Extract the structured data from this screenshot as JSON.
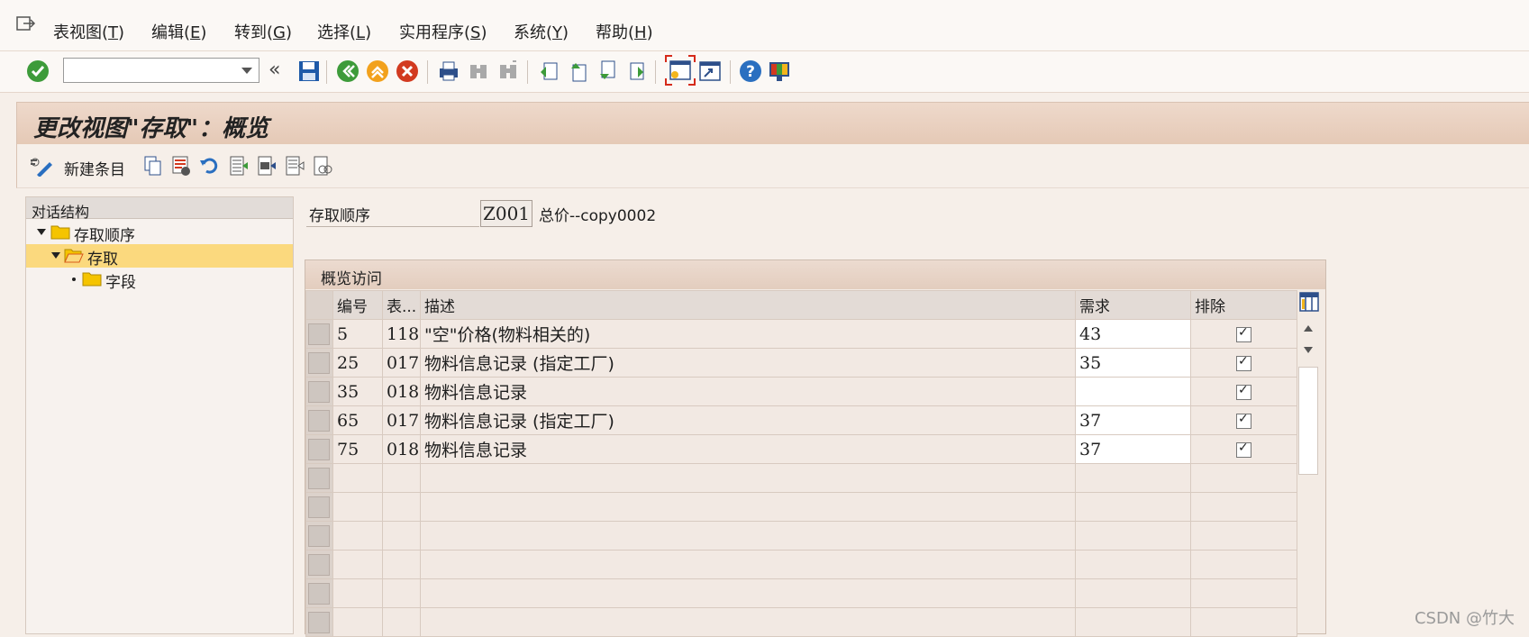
{
  "menubar": {
    "items": [
      {
        "label": "表视图(",
        "key": "T",
        "tail": ")"
      },
      {
        "label": "编辑(",
        "key": "E",
        "tail": ")"
      },
      {
        "label": "转到(",
        "key": "G",
        "tail": ")"
      },
      {
        "label": "选择(",
        "key": "L",
        "tail": ")"
      },
      {
        "label": "实用程序(",
        "key": "S",
        "tail": ")"
      },
      {
        "label": "系统(",
        "key": "Y",
        "tail": ")"
      },
      {
        "label": "帮助(",
        "key": "H",
        "tail": ")"
      }
    ]
  },
  "toolbar": {
    "command_field_value": "",
    "icons": [
      "enter-icon",
      "back-double-icon",
      "save-icon",
      "back-icon",
      "exit-icon",
      "cancel-icon",
      "print-icon",
      "find-icon",
      "find-next-icon",
      "first-page-icon",
      "previous-page-icon",
      "next-page-icon",
      "last-page-icon",
      "create-session-icon",
      "shortcut-icon",
      "help-icon",
      "layout-icon"
    ]
  },
  "title": "更改视图\"存取\"：概览",
  "app_toolbar": {
    "new_entries_label": "新建条目"
  },
  "dialog_structure": {
    "header": "对话结构",
    "nodes": [
      {
        "label": "存取顺序",
        "level": 0
      },
      {
        "label": "存取",
        "level": 1,
        "selected": true
      },
      {
        "label": "字段",
        "level": 2
      }
    ]
  },
  "access_sequence": {
    "label": "存取顺序",
    "value": "Z001",
    "description": "总价--copy0002"
  },
  "overview": {
    "title": "概览访问",
    "columns": [
      "编号",
      "表...",
      "描述",
      "需求",
      "排除"
    ],
    "rows": [
      {
        "no": "5",
        "table": "118",
        "desc": "\"空\"价格(物料相关的)",
        "req": "43",
        "excl": true
      },
      {
        "no": "25",
        "table": "017",
        "desc": "物料信息记录 (指定工厂)",
        "req": "35",
        "excl": true
      },
      {
        "no": "35",
        "table": "018",
        "desc": "物料信息记录",
        "req": "",
        "excl": true
      },
      {
        "no": "65",
        "table": "017",
        "desc": "物料信息记录 (指定工厂)",
        "req": "37",
        "excl": true
      },
      {
        "no": "75",
        "table": "018",
        "desc": "物料信息记录",
        "req": "37",
        "excl": true
      }
    ],
    "empty_rows": 6
  },
  "watermark": "CSDN @竹大"
}
